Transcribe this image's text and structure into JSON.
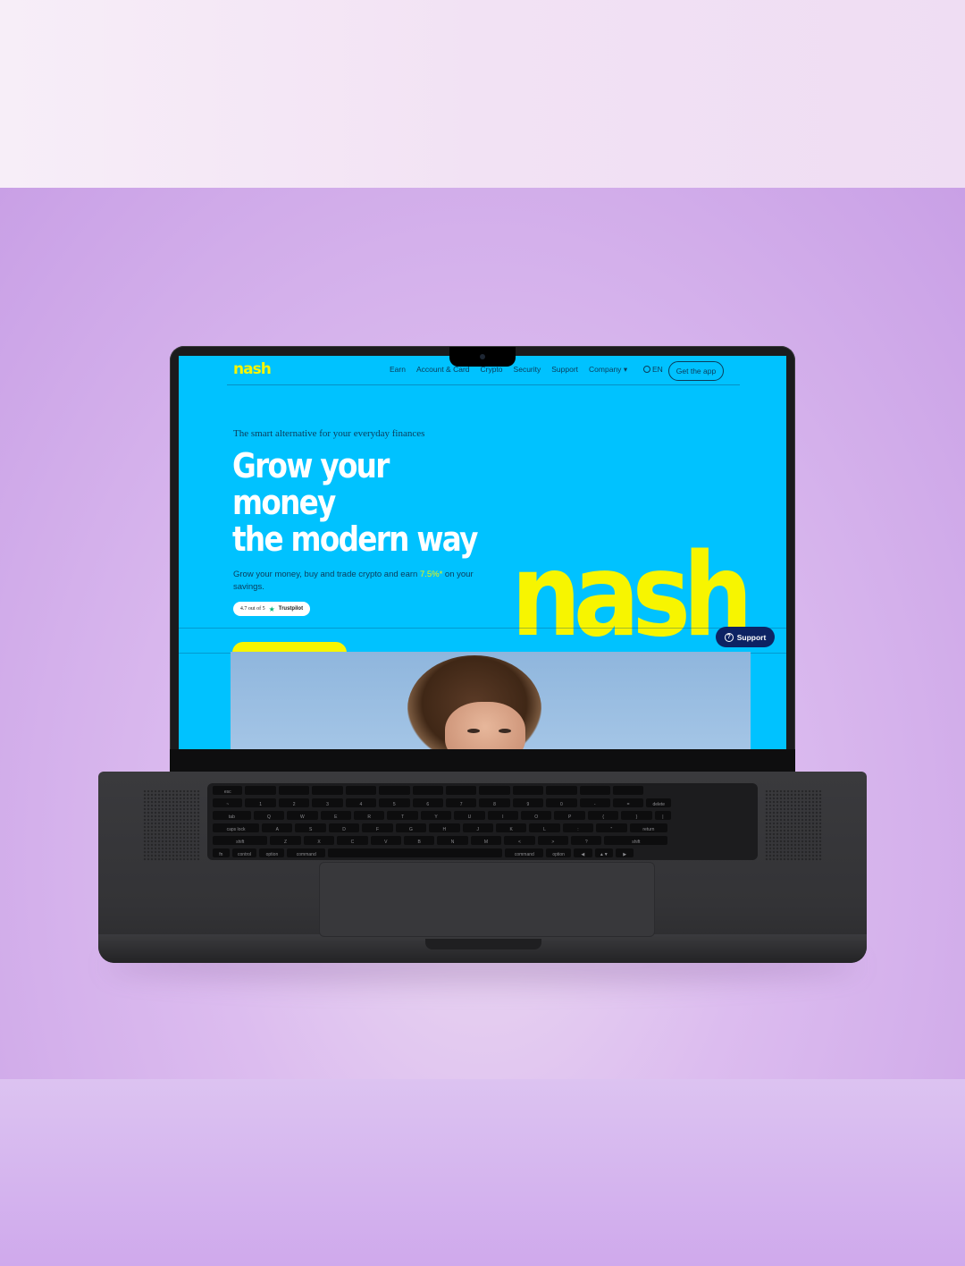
{
  "colors": {
    "site_bg": "#00c2ff",
    "brand_yellow": "#f7f500",
    "ink": "#0b3c5a",
    "support_bg": "#0d2363",
    "laptop_body": "#38383b"
  },
  "site": {
    "logo": "nash",
    "nav": {
      "items": [
        "Earn",
        "Account & Card",
        "Crypto",
        "Security",
        "Support",
        "Company"
      ],
      "company_caret": "▾",
      "language": "EN",
      "cta": "Get the app"
    },
    "hero": {
      "tagline": "The smart alternative for your everyday finances",
      "headline_lines": [
        "Grow your",
        "money",
        "the modern way"
      ],
      "description_before": "Grow your money, buy and trade crypto and earn ",
      "rate": "7.5%*",
      "description_after": " on your savings.",
      "rating": "4.7 out of 5",
      "rating_source": "Trustpilot",
      "big_logo": "nash"
    },
    "support_button": "Support"
  },
  "keyboard": {
    "row1": [
      "esc",
      "",
      "",
      "",
      "",
      "",
      "",
      "",
      "",
      "",
      "",
      "",
      ""
    ],
    "row2": [
      "~",
      "1",
      "2",
      "3",
      "4",
      "5",
      "6",
      "7",
      "8",
      "9",
      "0",
      "-",
      "=",
      "delete"
    ],
    "row3": [
      "tab",
      "Q",
      "W",
      "E",
      "R",
      "T",
      "Y",
      "U",
      "I",
      "O",
      "P",
      "{",
      "}",
      "|"
    ],
    "row4": [
      "caps lock",
      "A",
      "S",
      "D",
      "F",
      "G",
      "H",
      "J",
      "K",
      "L",
      ":",
      "\"",
      "return"
    ],
    "row5": [
      "shift",
      "Z",
      "X",
      "C",
      "V",
      "B",
      "N",
      "M",
      "<",
      ">",
      "?",
      "shift"
    ],
    "row6": [
      "fn",
      "control",
      "option",
      "command",
      "",
      "command",
      "option",
      "◀",
      "▲▼",
      "▶"
    ]
  }
}
